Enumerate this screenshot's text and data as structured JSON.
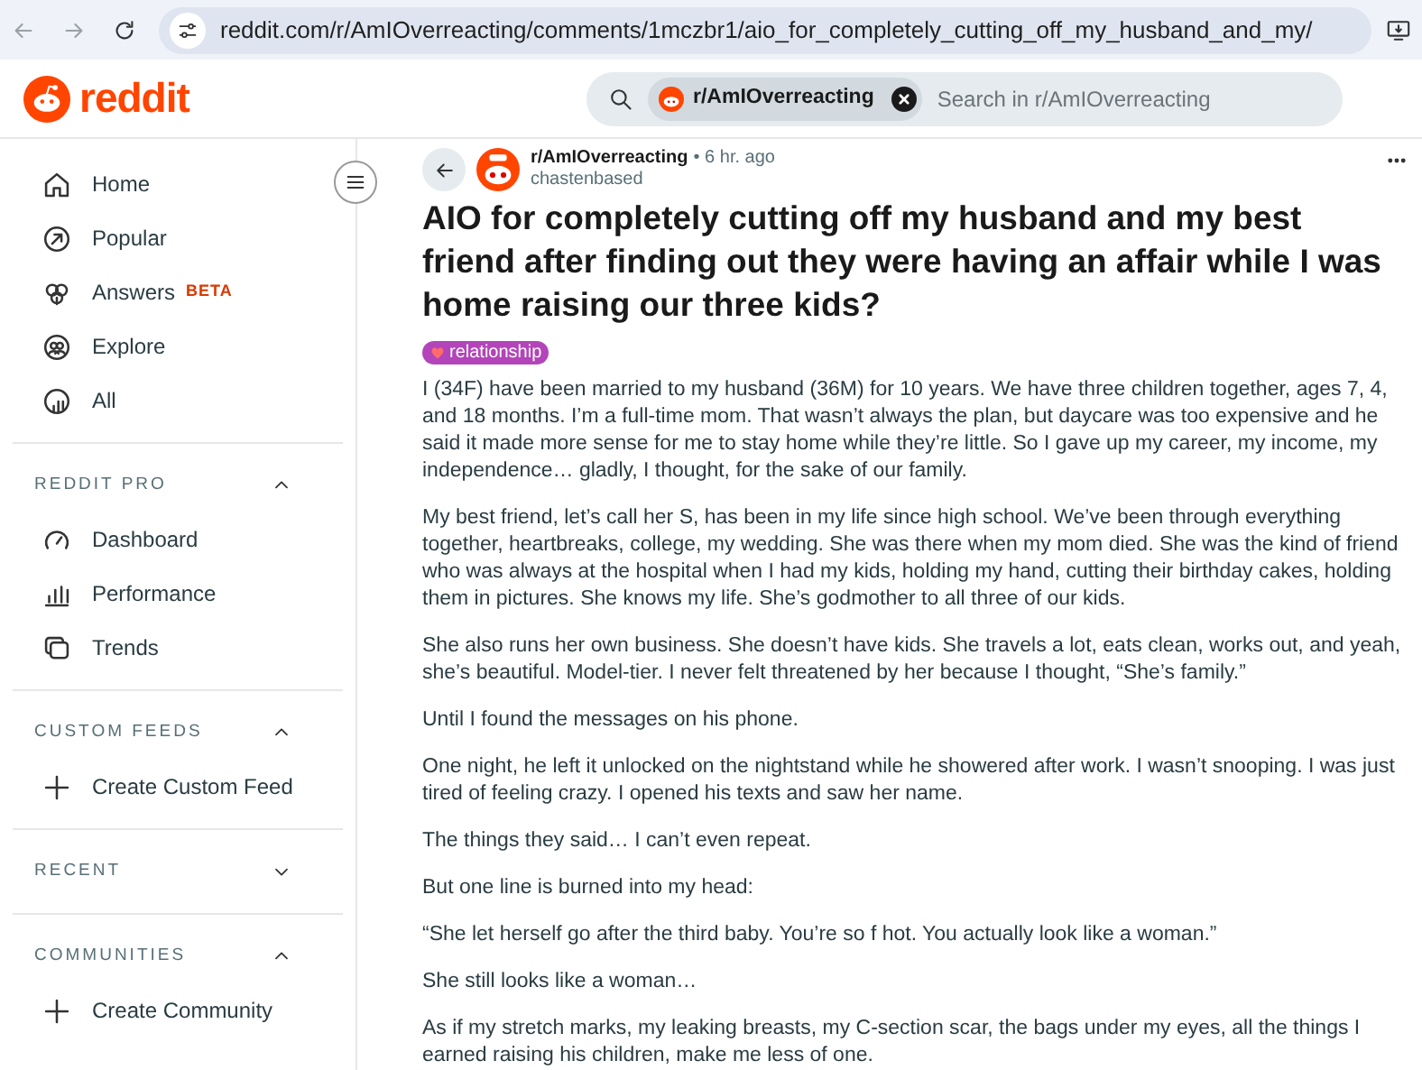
{
  "browser": {
    "url": "reddit.com/r/AmIOverreacting/comments/1mczbr1/aio_for_completely_cutting_off_my_husband_and_my/"
  },
  "header": {
    "logo": "reddit",
    "search": {
      "chip": "r/AmIOverreacting",
      "placeholder": "Search in r/AmIOverreacting"
    }
  },
  "sidebar": {
    "items": [
      {
        "label": "Home"
      },
      {
        "label": "Popular"
      },
      {
        "label": "Answers",
        "badge": "BETA"
      },
      {
        "label": "Explore"
      },
      {
        "label": "All"
      }
    ],
    "sections": [
      {
        "title": "REDDIT PRO",
        "expanded": true,
        "items": [
          {
            "label": "Dashboard"
          },
          {
            "label": "Performance"
          },
          {
            "label": "Trends"
          }
        ]
      },
      {
        "title": "CUSTOM FEEDS",
        "expanded": true,
        "items": [
          {
            "label": "Create Custom Feed"
          }
        ]
      },
      {
        "title": "RECENT",
        "expanded": false
      },
      {
        "title": "COMMUNITIES",
        "expanded": true,
        "items": [
          {
            "label": "Create Community"
          }
        ]
      }
    ]
  },
  "post": {
    "subreddit": "r/AmIOverreacting",
    "time": "• 6 hr. ago",
    "author": "chastenbased",
    "title": "AIO for completely cutting off my husband and my best friend after finding out they were having an affair while I was home raising our three kids?",
    "flair": "relationship",
    "paragraphs": [
      "I (34F) have been married to my husband (36M) for 10 years. We have three children together, ages 7, 4, and 18 months. I’m a full-time mom. That wasn’t always the plan, but daycare was too expensive and he said it made more sense for me to stay home while they’re little. So I gave up my career, my income, my independence… gladly, I thought, for the sake of our family.",
      "My best friend, let’s call her S, has been in my life since high school. We’ve been through everything together, heartbreaks, college, my wedding. She was there when my mom died. She was the kind of friend who was always at the hospital when I had my kids, holding my hand, cutting their birthday cakes, holding them in pictures. She knows my life. She’s godmother to all three of our kids.",
      "She also runs her own business. She doesn’t have kids. She travels a lot, eats clean, works out, and yeah, she’s beautiful. Model-tier. I never felt threatened by her because I thought, “She’s family.”",
      "Until I found the messages on his phone.",
      "One night, he left it unlocked on the nightstand while he showered after work. I wasn’t snooping. I was just tired of feeling crazy. I opened his texts and saw her name.",
      "The things they said… I can’t even repeat.",
      "But one line is burned into my head:",
      "“She let herself go after the third baby. You’re so f hot. You actually look like a woman.”",
      "She still looks like a woman…",
      "As if my stretch marks, my leaking breasts, my C-section scar, the bags under my eyes, all the things I earned raising his children, make me less of one."
    ]
  }
}
